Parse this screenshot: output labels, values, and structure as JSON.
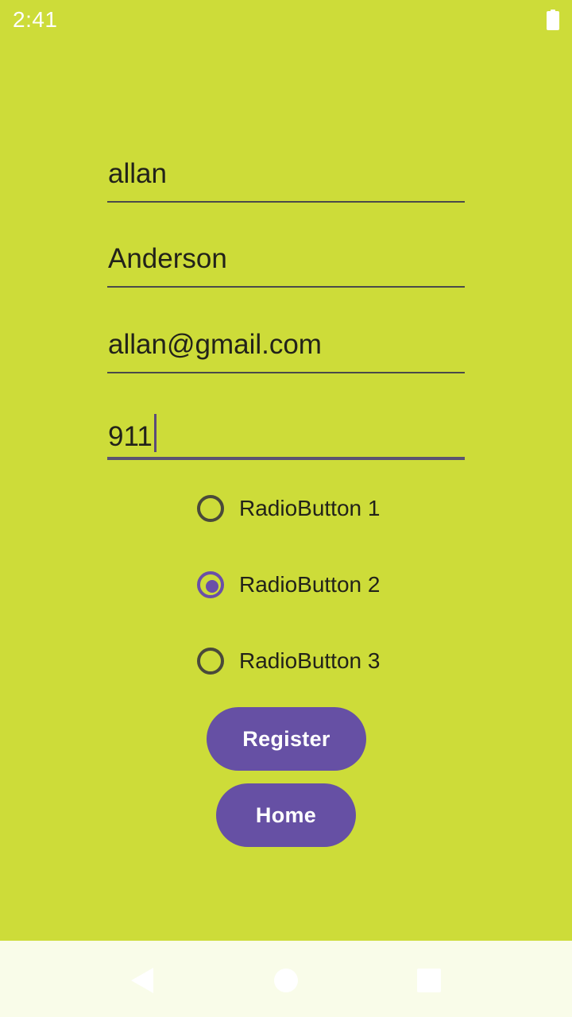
{
  "status_bar": {
    "time": "2:41",
    "battery_icon": "battery-full-icon"
  },
  "form": {
    "fields": [
      {
        "value": "allan"
      },
      {
        "value": "Anderson"
      },
      {
        "value": "allan@gmail.com"
      },
      {
        "value": "911",
        "focused": true
      }
    ],
    "radio_options": [
      {
        "label": "RadioButton 1",
        "checked": false
      },
      {
        "label": "RadioButton 2",
        "checked": true
      },
      {
        "label": "RadioButton 3",
        "checked": false
      }
    ],
    "register_label": "Register",
    "home_label": "Home"
  },
  "nav_bar": {
    "back_icon": "back-triangle-icon",
    "home_icon": "home-circle-icon",
    "recents_icon": "recents-square-icon"
  },
  "colors": {
    "background": "#cddc39",
    "accent": "#6650a4",
    "nav_background": "#f9fce9"
  }
}
